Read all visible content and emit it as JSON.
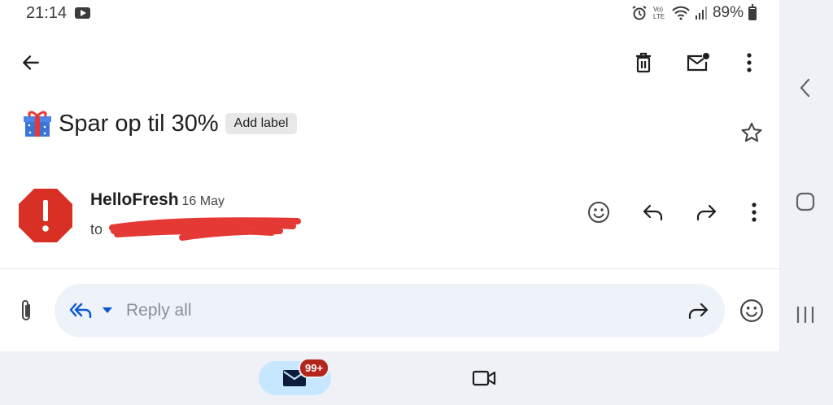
{
  "status_bar": {
    "time": "21:14",
    "volte": "Vo) LTE",
    "battery_percent": "89%"
  },
  "toolbar": {
    "back_icon": "arrow-back-icon",
    "delete_icon": "trash-icon",
    "mark_unread_icon": "mark-unread-icon",
    "more_icon": "more-vert-icon"
  },
  "email": {
    "subject": "Spar op til 30%",
    "subject_emoji": "gift-icon",
    "add_label": "Add label",
    "sender": "HelloFresh",
    "date": "16 May",
    "to_prefix": "to"
  },
  "reply_bar": {
    "placeholder": "Reply all"
  },
  "bottom_nav": {
    "mail_badge": "99+"
  },
  "colors": {
    "accent": "#0b57d0",
    "badge": "#b3261e",
    "avatar": "#d93025",
    "redaction": "#e53935"
  }
}
